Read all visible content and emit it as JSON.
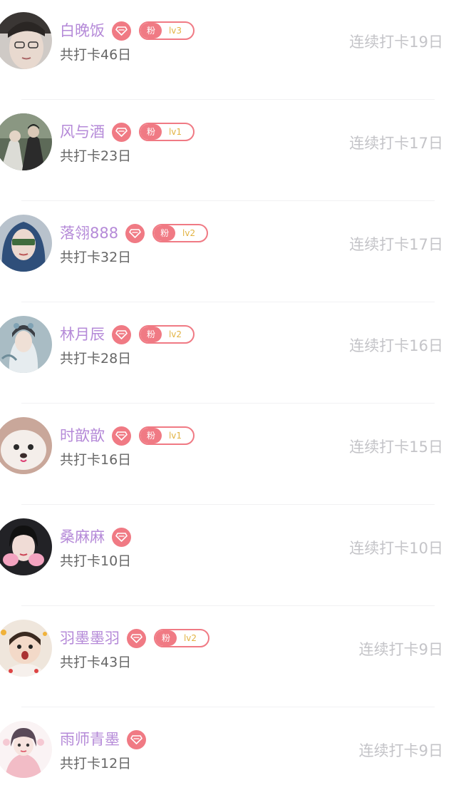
{
  "colors": {
    "name": "#b58ad8",
    "badge": "#f07a84",
    "fan_level": "#e2b342",
    "total": "#666666",
    "streak": "#c4c4c8",
    "divider": "#f1f1f3"
  },
  "rows": [
    {
      "name": "白晚饭",
      "fan_label": "粉",
      "level": "lv3",
      "total": "共打卡46日",
      "streak": "连续打卡19日",
      "has_fan": true,
      "avatar": "photo-male"
    },
    {
      "name": "风与酒",
      "fan_label": "粉",
      "level": "lv1",
      "total": "共打卡23日",
      "streak": "连续打卡17日",
      "has_fan": true,
      "avatar": "couple-photo"
    },
    {
      "name": "落翎888",
      "fan_label": "粉",
      "level": "lv2",
      "total": "共打卡32日",
      "streak": "连续打卡17日",
      "has_fan": true,
      "avatar": "blue-hair-girl"
    },
    {
      "name": "林月辰",
      "fan_label": "粉",
      "level": "lv2",
      "total": "共打卡28日",
      "streak": "连续打卡16日",
      "has_fan": true,
      "avatar": "ancient-costume"
    },
    {
      "name": "时歆歆",
      "fan_label": "粉",
      "level": "lv1",
      "total": "共打卡16日",
      "streak": "连续打卡15日",
      "has_fan": true,
      "avatar": "fluffy-dog"
    },
    {
      "name": "桑麻麻",
      "fan_label": "",
      "level": "",
      "total": "共打卡10日",
      "streak": "连续打卡10日",
      "has_fan": false,
      "avatar": "girl-pink-hands"
    },
    {
      "name": "羽墨墨羽",
      "fan_label": "粉",
      "level": "lv2",
      "total": "共打卡43日",
      "streak": "连续打卡9日",
      "has_fan": true,
      "avatar": "baby-photo"
    },
    {
      "name": "雨师青墨",
      "fan_label": "",
      "level": "",
      "total": "共打卡12日",
      "streak": "连续打卡9日",
      "has_fan": false,
      "avatar": "anime-girl"
    }
  ]
}
